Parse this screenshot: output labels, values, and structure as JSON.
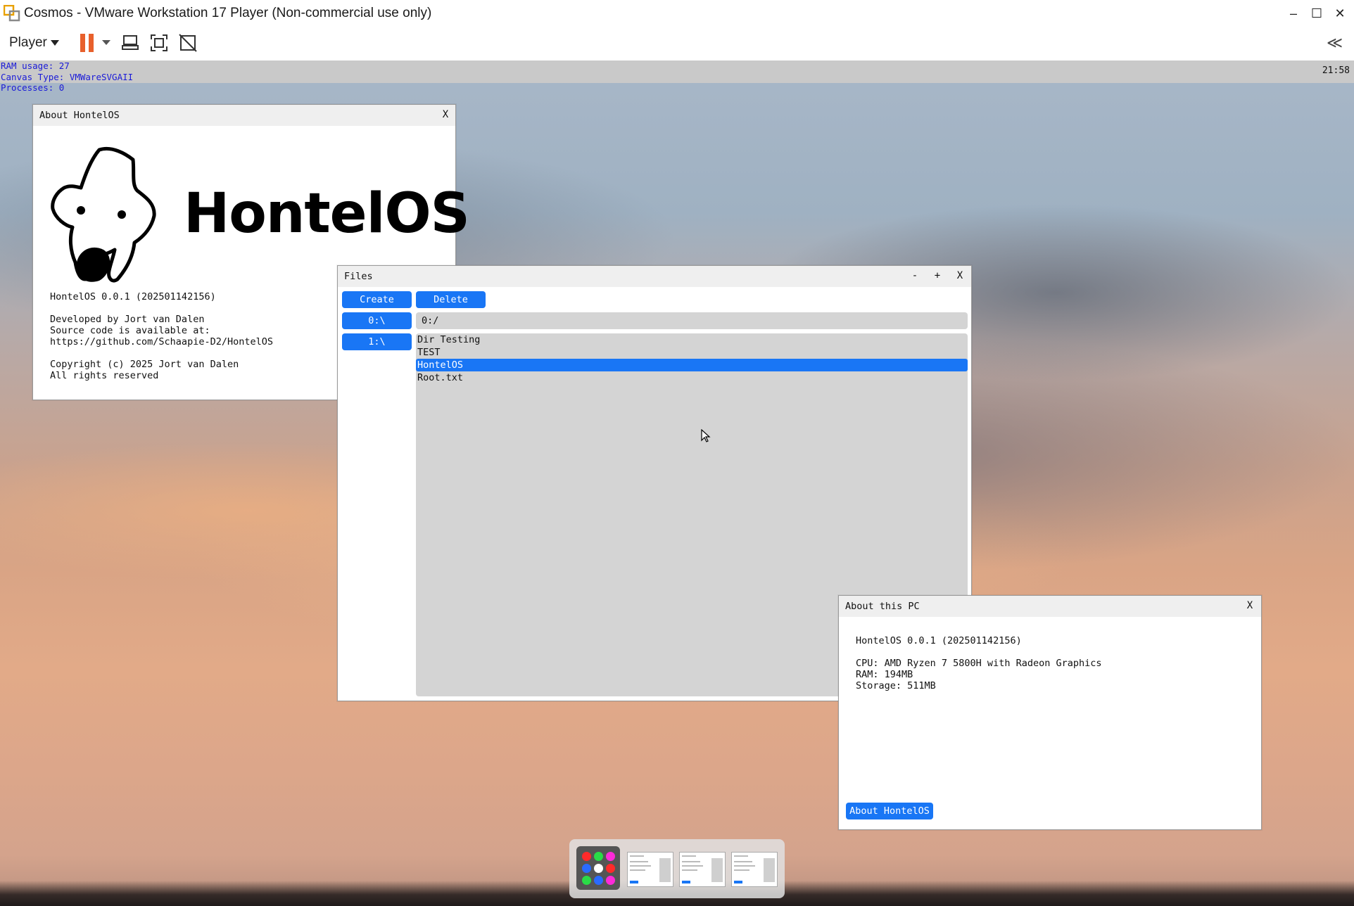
{
  "host": {
    "window_title": "Cosmos - VMware Workstation 17 Player (Non-commercial use only)",
    "player_label": "Player",
    "controls": {
      "minimize": "–",
      "maximize": "☐",
      "close": "✕"
    },
    "collapse_label": "≪"
  },
  "guest": {
    "info": {
      "ram": "RAM usage: 27",
      "canvas": "Canvas Type: VMWareSVGAII",
      "processes": "Processes: 0"
    },
    "clock": "21:58",
    "about_hontelos": {
      "title": "About HontelOS",
      "close": "X",
      "logo_text": "HontelOS",
      "version": "HontelOS 0.0.1 (202501142156)",
      "developed_by": "Developed by Jort van Dalen",
      "source_line": "Source code is available at:",
      "url": "https://github.com/Schaapie-D2/HontelOS",
      "copyright": "Copyright (c) 2025 Jort van Dalen",
      "rights": "All rights reserved"
    },
    "files": {
      "title": "Files",
      "minimize": "-",
      "maximize": "+",
      "close": "X",
      "create_label": "Create",
      "delete_label": "Delete",
      "drives": [
        "0:\\",
        "1:\\"
      ],
      "path": "0:/",
      "items": [
        "Dir Testing",
        "TEST",
        "HontelOS",
        "Root.txt"
      ],
      "selected_index": 2
    },
    "about_pc": {
      "title": "About this PC",
      "close": "X",
      "version": "HontelOS 0.0.1 (202501142156)",
      "cpu": "CPU: AMD Ryzen 7 5800H with Radeon Graphics",
      "ram": "RAM: 194MB",
      "storage": "Storage: 511MB",
      "button_label": "About HontelOS"
    }
  }
}
